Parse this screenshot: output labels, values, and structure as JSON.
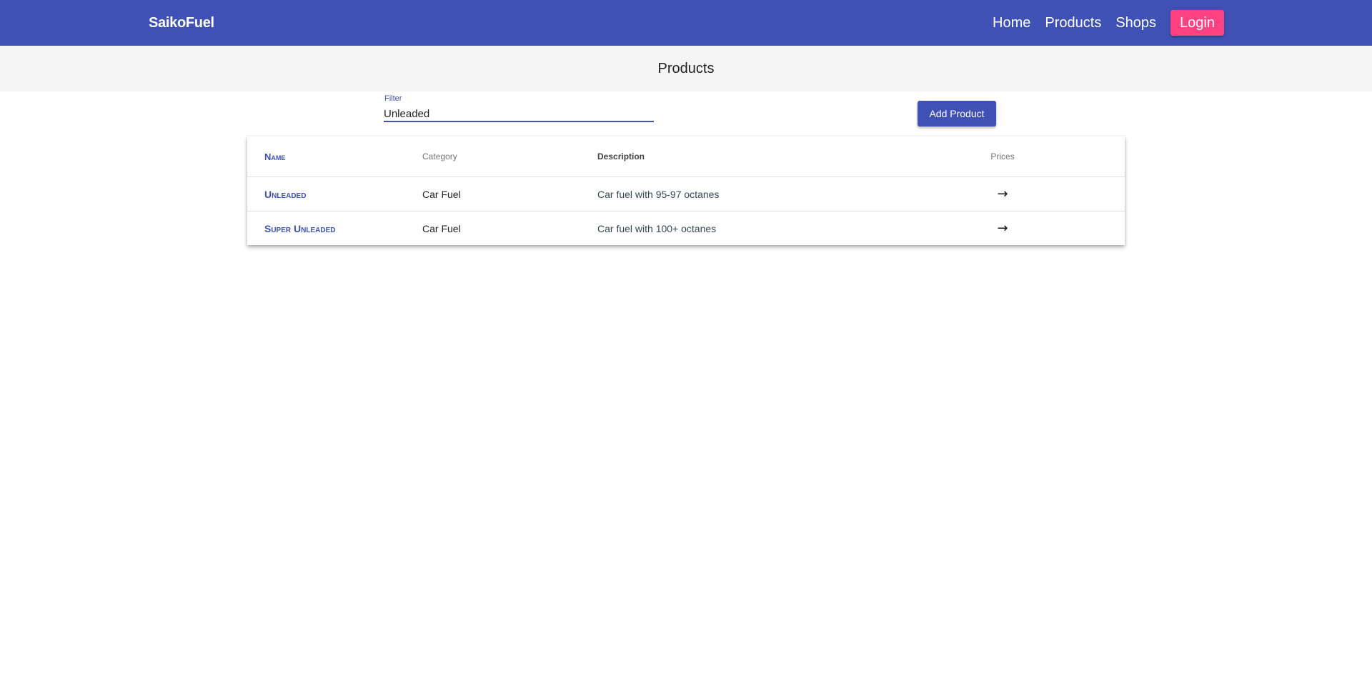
{
  "navbar": {
    "brand": "SaikoFuel",
    "links": [
      "Home",
      "Products",
      "Shops"
    ],
    "login_label": "Login"
  },
  "page": {
    "title": "Products"
  },
  "filter": {
    "label": "Filter",
    "value": "Unleaded"
  },
  "add_button_label": "Add Product",
  "table": {
    "headers": {
      "name": "Name",
      "category": "Category",
      "description": "Description",
      "prices": "Prices"
    },
    "rows": [
      {
        "name": "Unleaded",
        "category": "Car Fuel",
        "description": "Car fuel with 95-97 octanes",
        "prices_icon": "→"
      },
      {
        "name": "Super Unleaded",
        "category": "Car Fuel",
        "description": "Car fuel with 100+ octanes",
        "prices_icon": "→"
      }
    ]
  },
  "colors": {
    "primary": "#3f51b5",
    "accent": "#ff4081",
    "header_band": "#f5f5f5"
  }
}
